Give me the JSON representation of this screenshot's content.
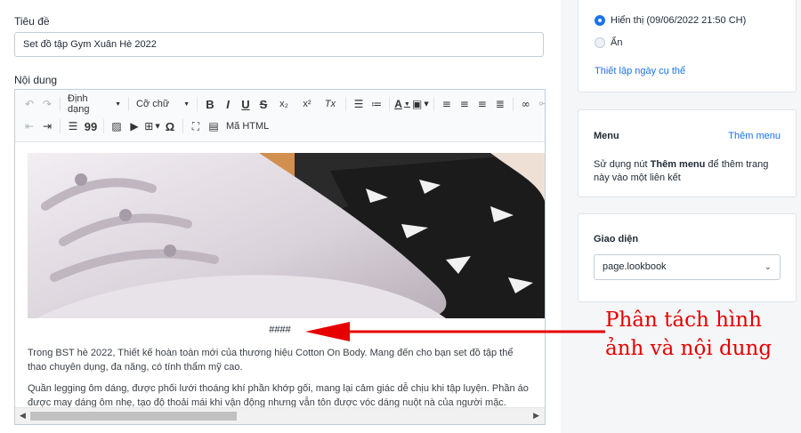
{
  "form": {
    "title_label": "Tiêu đề",
    "title_value": "Set đồ tập Gym Xuân Hè 2022",
    "content_label": "Nội dung"
  },
  "toolbar": {
    "format_label": "Định dạng",
    "fontsize_label": "Cỡ chữ",
    "bold": "B",
    "italic": "I",
    "underline": "U",
    "strike": "S",
    "subscript": "x₂",
    "superscript": "x²",
    "clear_format": "Tx",
    "quote": "99",
    "omega": "Ω",
    "html_label": "Mã HTML"
  },
  "content": {
    "separator": "####",
    "paragraph_1": "Trong BST hè 2022,  Thiết kế hoàn toàn mới của thương hiệu Cotton On Body. Mang đến cho bạn set đồ tập thể thao chuyên dụng, đa năng, có tính thẩm mỹ cao.",
    "paragraph_2": "Quần legging ôm dáng, được phối lưới thoáng khí phần khớp gối, mang lại cảm giác dễ chịu khi tập luyện. Phần áo được may dáng ôm nhẹ, tạo độ thoải mái khi vận động nhưng vẫn tôn được vóc dáng nuột nà của người mặc."
  },
  "visibility": {
    "visible_label": "Hiển thị (09/06/2022 21:50 CH)",
    "hidden_label": "Ẩn",
    "schedule_link": "Thiết lập ngày cụ thể"
  },
  "menu": {
    "title": "Menu",
    "add_link": "Thêm menu",
    "description_prefix": "Sử dụng nút ",
    "description_bold": "Thêm menu",
    "description_suffix": " để thêm trang này vào một liên kết"
  },
  "theme": {
    "title": "Giao diện",
    "selected": "page.lookbook"
  },
  "annotation": {
    "text": "Phân tách hình ảnh và nội dung",
    "color": "#e60000"
  },
  "colors": {
    "accent": "#1a73e8",
    "background": "#f4f6f8"
  }
}
